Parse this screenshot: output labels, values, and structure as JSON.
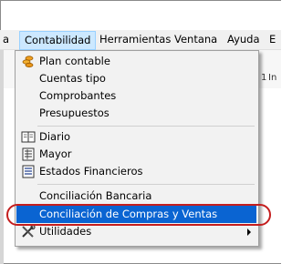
{
  "menubar": {
    "items": [
      {
        "label": "a"
      },
      {
        "label": "Contabilidad"
      },
      {
        "label": "Herramientas"
      },
      {
        "label": "Ventana"
      },
      {
        "label": "Ayuda"
      },
      {
        "label": "E"
      }
    ]
  },
  "toolbar": {
    "right_labels": [
      "1",
      "In"
    ]
  },
  "menu": {
    "items": [
      {
        "label": "Plan contable",
        "icon": "coins-icon"
      },
      {
        "label": "Cuentas tipo"
      },
      {
        "label": "Comprobantes"
      },
      {
        "label": "Presupuestos"
      },
      {
        "label": "Diario",
        "icon": "book-icon"
      },
      {
        "label": "Mayor",
        "icon": "ledger-icon"
      },
      {
        "label": "Estados Financieros",
        "icon": "report-icon"
      },
      {
        "label": "Conciliación Bancaria"
      },
      {
        "label": "Conciliación de Compras y Ventas",
        "highlighted": true
      },
      {
        "label": "Utilidades",
        "icon": "tools-icon",
        "submenu": true
      }
    ]
  },
  "colors": {
    "highlight": "#0a64d2",
    "annotation_circle": "#c41e1e",
    "menubar_selected": "#cce8ff"
  }
}
